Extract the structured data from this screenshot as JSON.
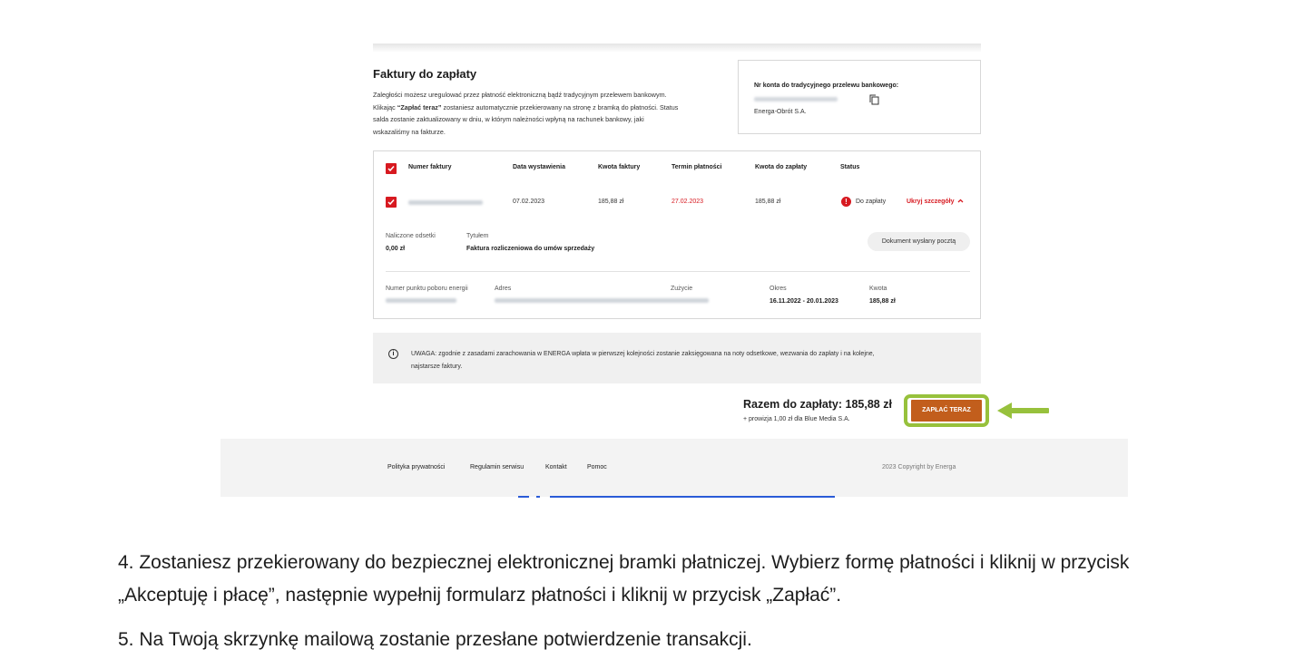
{
  "invoices": {
    "title": "Faktury do zapłaty",
    "intro_1": "Zaległości możesz uregulować przez płatność elektroniczną bądź tradycyjnym przelewem bankowym.",
    "intro_2_prefix": "Klikając ",
    "intro_2_bold": "“Zapłać teraz”",
    "intro_2_suffix": " zostaniesz automatycznie przekierowany na stronę z bramką do płatności. Status",
    "intro_3": "salda zostanie zaktualizowany w dniu, w którym należności wpłyną na rachunek bankowy, jaki",
    "intro_4": "wskazaliśmy na fakturze."
  },
  "account": {
    "label": "Nr konta do tradycyjnego przelewu bankowego:",
    "company": "Energa-Obrót S.A."
  },
  "table": {
    "headers": {
      "number": "Numer faktury",
      "issue_date": "Data wystawienia",
      "amount": "Kwota faktury",
      "due_date": "Termin płatności",
      "to_pay": "Kwota do zapłaty",
      "status": "Status"
    },
    "row": {
      "issue_date": "07.02.2023",
      "amount": "185,88 zł",
      "due_date": "27.02.2023",
      "to_pay": "185,88 zł",
      "status": "Do zapłaty",
      "toggle": "Ukryj szczegóły"
    },
    "details": {
      "interest_label": "Naliczone odsetki",
      "interest_value": "0,00 zł",
      "title_label": "Tytułem",
      "title_value": "Faktura rozliczeniowa do umów sprzedaży",
      "document_pill": "Dokument wysłany pocztą",
      "ppe_label": "Numer punktu poboru energii",
      "address_label": "Adres",
      "usage_label": "Zużycie",
      "period_label": "Okres",
      "period_value": "16.11.2022 - 20.01.2023",
      "amount_label": "Kwota",
      "amount_value": "185,88 zł"
    }
  },
  "notice": {
    "line_1": "UWAGA: zgodnie z zasadami zarachowania w ENERGA wpłata w pierwszej kolejności zostanie zaksięgowana na noty odsetkowe, wezwania do zapłaty i na kolejne,",
    "line_2": "najstarsze faktury."
  },
  "summary": {
    "total": "Razem do zapłaty: 185,88 zł",
    "fee": "+ prowizja 1,00 zł dla Blue Media S.A.",
    "pay_button": "ZAPŁAĆ TERAZ"
  },
  "footer": {
    "links": [
      "Polityka prywatności",
      "Regulamin serwisu",
      "Kontakt",
      "Pomoc"
    ],
    "copyright": "2023 Copyright by Energa"
  },
  "article": {
    "step4_line1": "4. Zostaniesz przekierowany do bezpiecznej elektronicznej bramki płatniczej. Wybierz formę płatności i kliknij w przycisk",
    "step4_line2": "„Akceptuję i płacę”, następnie wypełnij formularz płatności i kliknij w przycisk „Zapłać”.",
    "step5": "5. Na Twoją skrzynkę mailową zostanie przesłane potwierdzenie transakcji."
  },
  "colors": {
    "accent_red": "#d71920",
    "pay_button": "#c25e1c",
    "highlight_green": "#97c13c"
  }
}
